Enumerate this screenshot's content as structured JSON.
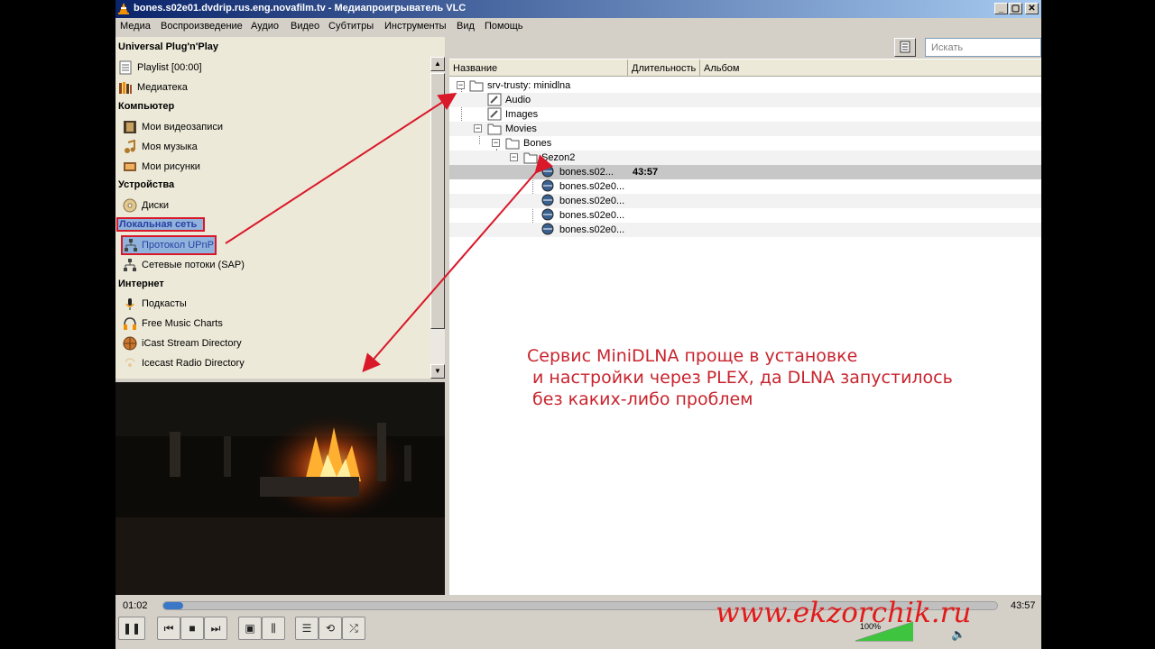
{
  "window": {
    "title": "bones.s02e01.dvdrip.rus.eng.novafilm.tv - Медиапроигрыватель VLC",
    "controls": {
      "minimize": "_",
      "restore": "▢",
      "close": "✕"
    }
  },
  "menu": [
    "Медиа",
    "Воспроизведение",
    "Аудио",
    "Видео",
    "Субтитры",
    "Инструменты",
    "Вид",
    "Помощь"
  ],
  "sidebar": {
    "header": "Universal Plug'n'Play",
    "playlist": "Playlist [00:00]",
    "library": "Медиатека",
    "sec_computer": "Компьютер",
    "videos": "Мои видеозаписи",
    "music": "Моя музыка",
    "pictures": "Мои рисунки",
    "sec_devices": "Устройства",
    "discs": "Диски",
    "sec_lan": "Локальная сеть",
    "upnp": "Протокол UPnP",
    "sap": "Сетевые потоки (SAP)",
    "sec_internet": "Интернет",
    "podcasts": "Подкасты",
    "freemusic": "Free Music Charts",
    "icast": "iCast Stream Directory",
    "icecast": "Icecast Radio Directory"
  },
  "search": {
    "placeholder": "Искать"
  },
  "columns": {
    "name": "Название",
    "duration": "Длительность",
    "album": "Альбом"
  },
  "tree": {
    "root": "srv-trusty: minidlna",
    "audio": "Audio",
    "images": "Images",
    "movies": "Movies",
    "bones": "Bones",
    "sezon": "Sezon2",
    "files": [
      {
        "name": "bones.s02...",
        "duration": "43:57"
      },
      {
        "name": "bones.s02e0...",
        "duration": ""
      },
      {
        "name": "bones.s02e0...",
        "duration": ""
      },
      {
        "name": "bones.s02e0...",
        "duration": ""
      },
      {
        "name": "bones.s02e0...",
        "duration": ""
      }
    ]
  },
  "annotation": {
    "line1": "Сервис MiniDLNA проще в установке",
    "line2": " и настройки через PLEX, да DLNA запустилось",
    "line3": " без каких-либо проблем"
  },
  "player": {
    "current_time": "01:02",
    "total_time": "43:57",
    "progress": 0.024,
    "volume": "100%",
    "volume_level": 1.0
  },
  "watermark": "www.ekzorchik.ru",
  "colors": {
    "annotation_red": "#d9182a",
    "selection_gray": "#c7c7c7",
    "progress_blue": "#3a78c7"
  },
  "icons": [
    "vlc-cone-icon",
    "playlist-icon",
    "library-icon",
    "film-icon",
    "music-note-icon",
    "picture-icon",
    "disc-icon",
    "network-icon",
    "podcast-icon",
    "headphones-icon",
    "globe-icon",
    "folder-icon",
    "media-file-icon"
  ]
}
